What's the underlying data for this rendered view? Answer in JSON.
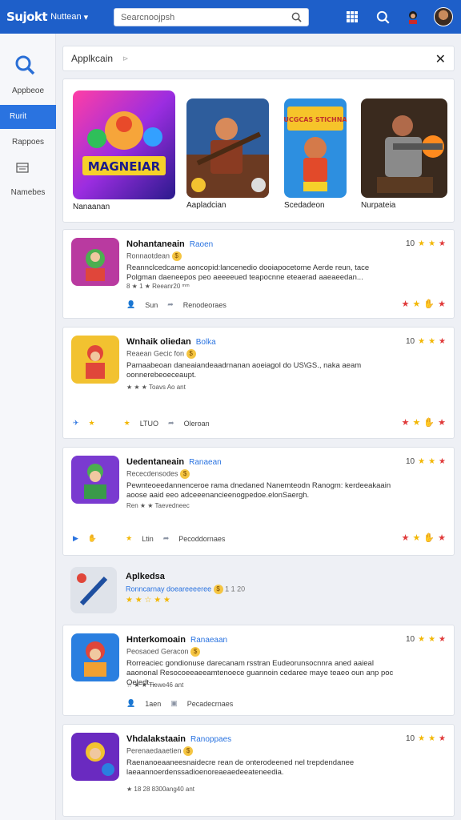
{
  "header": {
    "logo": "Sujokt",
    "app_name": "Nuttean",
    "search_placeholder": "Searcnoojpsh"
  },
  "sidebar": {
    "items": [
      {
        "label": "Appbeoe"
      },
      {
        "label": "Rurit"
      },
      {
        "label": "Rappoes"
      },
      {
        "label": "Namebes"
      }
    ]
  },
  "panel": {
    "title": "Applkcain",
    "subtitle": "⊳",
    "close": "✕"
  },
  "featured": [
    {
      "caption": "Nanaanan",
      "art_title": "MAGNEIAR"
    },
    {
      "caption": "Aapladcian"
    },
    {
      "caption": "Scedadeon",
      "art_title": "SUCGCAS STICHNAS"
    },
    {
      "caption": "Nurpateia"
    }
  ],
  "cards": [
    {
      "title": "Nohantaneain",
      "tag": "Raoen",
      "meta": "Ronnaotdean",
      "desc": "Reannclcedcame aoncopid:lancenedio dooiapocetome Aerde reun, tace Polgman daeneepos peo aeeeeued teapocnne eteaerad aaeaeedan...",
      "rating": "8 ★ 1 ★ Reeanr20 ᵐᵐ",
      "foot1": "Sun",
      "foot2": "Renodeoraes",
      "score": "10"
    },
    {
      "title": "Wnhaik oliedan",
      "tag": "Bolka",
      "meta": "Reaean Gecic fon",
      "desc": "Pamaabeoan daneaiandeaadrnanan aoeiagol do US\\GS., naka aeam oonnerebeoeceaupt.",
      "rating": "★ ★ ★ Toavs Ao ant",
      "foot1": "LTUO",
      "foot2": "Oleroan",
      "score": "10"
    },
    {
      "title": "Uedentaneain",
      "tag": "Ranaean",
      "meta": "Rececdensodes",
      "desc": "Pewnteoeedannenceroe rama dnedaned Nanemteodn Ranogm: kerdeeakaain aoose aaid eeo adceeenancieenogpedoe.elonSaergh.",
      "rating": "Ren ★ ★ Taevedneec",
      "foot1": "Ltin",
      "foot2": "Pecoddornaes",
      "score": "10"
    },
    {
      "simple": true,
      "title": "Aplkedsa",
      "meta": "Ronncarnay doeareeeeree",
      "rating": "★ ★ ☆ ★ ★",
      "badge_text": "1 1 20"
    },
    {
      "title": "Hnterkomoain",
      "tag": "Ranaeaan",
      "meta": "Peosaoed Geracon",
      "desc": "Rorreaciec gondionuse darecanam rsstran Eudeorunsocnnra aned aaieal aaononal Resocoeeaeeamtenoece guannoin cedaree maye teaeo oun anp poc Oeledt...",
      "rating": "☆ ★ ★ Tiewe46 ant",
      "foot1": "1aen",
      "foot2": "Pecadecrnaes",
      "score": "10"
    },
    {
      "title": "Vhdalakstaain",
      "tag": "Ranoppaes",
      "meta": "Perenaedaaetien",
      "desc": "Raenanoeaaneesnaidecre rean de onterodeened nel trepdendanee laeaannoerdenssadioenoreaeaedeeateneedia.",
      "rating": "★ 18 28 8300ang40 ant",
      "foot1": "",
      "foot2": "",
      "score": "10"
    }
  ]
}
